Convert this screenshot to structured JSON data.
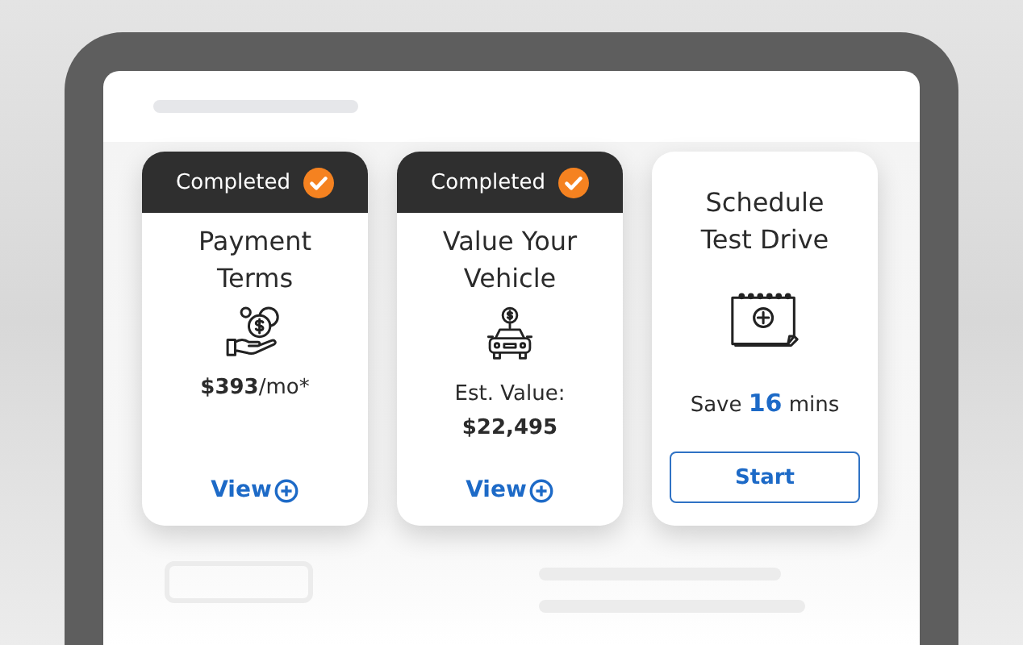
{
  "cards": [
    {
      "kind": "payment",
      "completed": true,
      "status_label": "Completed",
      "title": "Payment Terms",
      "lines": [
        "**$393**/mo*"
      ],
      "action": {
        "kind": "link",
        "label": "View"
      }
    },
    {
      "kind": "vehicle",
      "completed": true,
      "status_label": "Completed",
      "title": "Value Your Vehicle",
      "lines": [
        "Est. Value:",
        "**$22,495**"
      ],
      "action": {
        "kind": "link",
        "label": "View"
      }
    },
    {
      "kind": "schedule",
      "completed": false,
      "title": "Schedule Test Drive",
      "lines": [
        "Save **16** mins"
      ],
      "action": {
        "kind": "button",
        "label": "Start"
      }
    }
  ]
}
